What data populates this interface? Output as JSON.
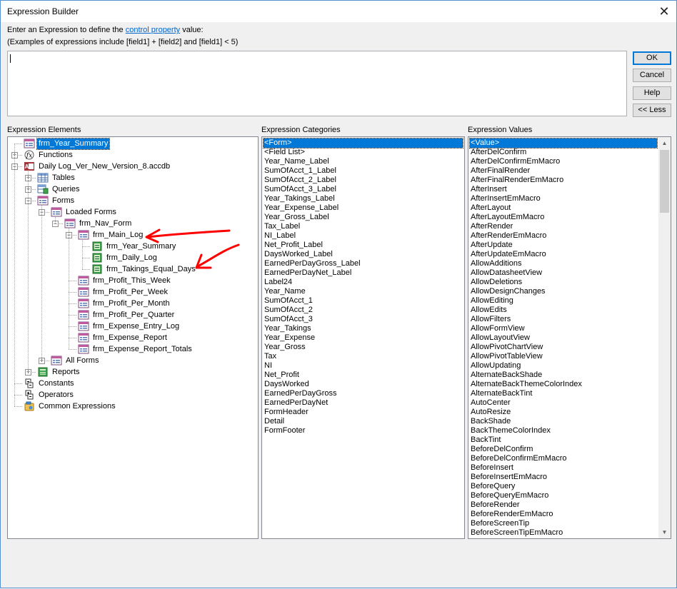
{
  "window": {
    "title": "Expression Builder",
    "close_glyph": "✕"
  },
  "intro": {
    "line1_prefix": "Enter an Expression to define the ",
    "line1_link": "control property",
    "line1_suffix": " value:",
    "line2": "(Examples of expressions include [field1] + [field2] and [field1] < 5)"
  },
  "buttons": {
    "ok": "OK",
    "cancel": "Cancel",
    "help": "Help",
    "less": "<< Less"
  },
  "sections": {
    "elements": "Expression Elements",
    "categories": "Expression Categories",
    "values": "Expression Values"
  },
  "tree": [
    {
      "label": "frm_Year_Summary",
      "icon": "form-icon",
      "level": 0,
      "selected": true
    },
    {
      "label": "Functions",
      "icon": "function-icon",
      "level": 0,
      "expander": "+"
    },
    {
      "label": "Daily Log_Ver_New_Version_8.accdb",
      "icon": "database-icon",
      "level": 0,
      "expander": "-"
    },
    {
      "label": "Tables",
      "icon": "table-icon",
      "level": 1,
      "expander": "+"
    },
    {
      "label": "Queries",
      "icon": "query-icon",
      "level": 1,
      "expander": "+"
    },
    {
      "label": "Forms",
      "icon": "form-icon",
      "level": 1,
      "expander": "-"
    },
    {
      "label": "Loaded Forms",
      "icon": "form-icon",
      "level": 2,
      "expander": "-"
    },
    {
      "label": "frm_Nav_Form",
      "icon": "form-icon",
      "level": 3,
      "expander": "-"
    },
    {
      "label": "frm_Main_Log",
      "icon": "form-icon",
      "level": 4,
      "expander": "-"
    },
    {
      "label": "frm_Year_Summary",
      "icon": "subform-icon",
      "level": 5
    },
    {
      "label": "frm_Daily_Log",
      "icon": "subform-icon",
      "level": 5
    },
    {
      "label": "frm_Takings_Equal_Days",
      "icon": "subform-icon",
      "level": 5
    },
    {
      "label": "frm_Profit_This_Week",
      "icon": "form-icon",
      "level": 4
    },
    {
      "label": "frm_Profit_Per_Week",
      "icon": "form-icon",
      "level": 4
    },
    {
      "label": "frm_Profit_Per_Month",
      "icon": "form-icon",
      "level": 4
    },
    {
      "label": "frm_Profit_Per_Quarter",
      "icon": "form-icon",
      "level": 4
    },
    {
      "label": "frm_Expense_Entry_Log",
      "icon": "form-icon",
      "level": 4
    },
    {
      "label": "frm_Expense_Report",
      "icon": "form-icon",
      "level": 4
    },
    {
      "label": "frm_Expense_Report_Totals",
      "icon": "form-icon",
      "level": 4
    },
    {
      "label": "All Forms",
      "icon": "form-icon",
      "level": 2,
      "expander": "+"
    },
    {
      "label": "Reports",
      "icon": "report-icon",
      "level": 1,
      "expander": "+"
    },
    {
      "label": "Constants",
      "icon": "constants-icon",
      "level": 0
    },
    {
      "label": "Operators",
      "icon": "operators-icon",
      "level": 0
    },
    {
      "label": "Common Expressions",
      "icon": "common-expressions-icon",
      "level": 0
    }
  ],
  "categories": [
    "<Form>",
    "<Field List>",
    "Year_Name_Label",
    "SumOfAcct_1_Label",
    "SumOfAcct_2_Label",
    "SumOfAcct_3_Label",
    "Year_Takings_Label",
    "Year_Expense_Label",
    "Year_Gross_Label",
    "Tax_Label",
    "NI_Label",
    "Net_Profit_Label",
    "DaysWorked_Label",
    "EarnedPerDayGross_Label",
    "EarnedPerDayNet_Label",
    "Label24",
    "Year_Name",
    "SumOfAcct_1",
    "SumOfAcct_2",
    "SumOfAcct_3",
    "Year_Takings",
    "Year_Expense",
    "Year_Gross",
    "Tax",
    "NI",
    "Net_Profit",
    "DaysWorked",
    "EarnedPerDayGross",
    "EarnedPerDayNet",
    "FormHeader",
    "Detail",
    "FormFooter"
  ],
  "values": [
    "<Value>",
    "AfterDelConfirm",
    "AfterDelConfirmEmMacro",
    "AfterFinalRender",
    "AfterFinalRenderEmMacro",
    "AfterInsert",
    "AfterInsertEmMacro",
    "AfterLayout",
    "AfterLayoutEmMacro",
    "AfterRender",
    "AfterRenderEmMacro",
    "AfterUpdate",
    "AfterUpdateEmMacro",
    "AllowAdditions",
    "AllowDatasheetView",
    "AllowDeletions",
    "AllowDesignChanges",
    "AllowEditing",
    "AllowEdits",
    "AllowFilters",
    "AllowFormView",
    "AllowLayoutView",
    "AllowPivotChartView",
    "AllowPivotTableView",
    "AllowUpdating",
    "AlternateBackShade",
    "AlternateBackThemeColorIndex",
    "AlternateBackTint",
    "AutoCenter",
    "AutoResize",
    "BackShade",
    "BackThemeColorIndex",
    "BackTint",
    "BeforeDelConfirm",
    "BeforeDelConfirmEmMacro",
    "BeforeInsert",
    "BeforeInsertEmMacro",
    "BeforeQuery",
    "BeforeQueryEmMacro",
    "BeforeRender",
    "BeforeRenderEmMacro",
    "BeforeScreenTip",
    "BeforeScreenTipEmMacro"
  ],
  "colors": {
    "selection": "#0078d7",
    "annotation_arrow": "#ff0000",
    "link": "#0066cc"
  }
}
